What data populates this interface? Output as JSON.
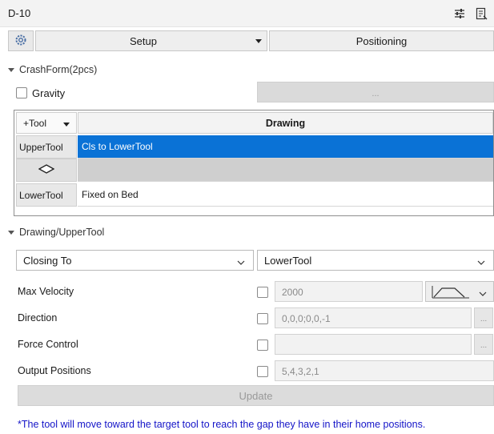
{
  "window": {
    "title": "D-10"
  },
  "icons": {
    "settings_sliders": "sliders-icon",
    "document": "document-icon",
    "gear": "gear-icon",
    "diamond": "diamond-icon",
    "profile": "trapezoid-profile-icon"
  },
  "toolbar": {
    "setup_label": "Setup",
    "positioning_label": "Positioning"
  },
  "crashform": {
    "header": "CrashForm(2pcs)",
    "gravity_label": "Gravity",
    "gravity_checked": false,
    "gravity_button": "..."
  },
  "tool_table": {
    "col1_header": "+Tool",
    "col2_header": "Drawing",
    "rows": [
      {
        "tool": "UpperTool",
        "drawing": "Cls to LowerTool",
        "selected": true
      },
      {
        "tool": "LowerTool",
        "drawing": "Fixed on Bed",
        "selected": false
      }
    ]
  },
  "drawing": {
    "header": "Drawing/UpperTool",
    "mode": "Closing To",
    "target": "LowerTool",
    "max_velocity": {
      "label": "Max Velocity",
      "checked": false,
      "value": "2000"
    },
    "direction": {
      "label": "Direction",
      "checked": false,
      "value": "0,0,0;0,0,-1",
      "button": "..."
    },
    "force_control": {
      "label": "Force Control",
      "checked": false,
      "value": "",
      "button": "..."
    },
    "output_positions": {
      "label": "Output Positions",
      "checked": false,
      "value": "5,4,3,2,1"
    },
    "update_label": "Update"
  },
  "note": "*The tool will move toward the target tool to reach the gap they have in their home positions.",
  "colors": {
    "selection": "#0a72d6",
    "note_text": "#1414c8"
  }
}
